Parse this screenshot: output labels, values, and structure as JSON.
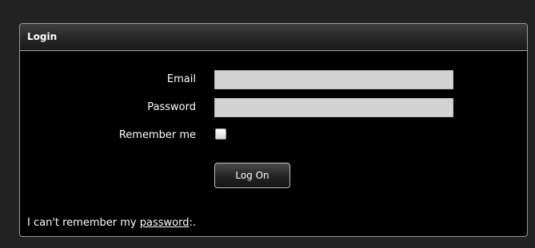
{
  "login_panel": {
    "title": "Login",
    "email_label": "Email",
    "email_value": "",
    "password_label": "Password",
    "password_value": "",
    "remember_label": "Remember me",
    "remember_checked": false,
    "submit_label": "Log On",
    "forgot_prefix": "I can't remember my ",
    "forgot_link": "password",
    "forgot_suffix": ":."
  },
  "colors": {
    "page_background": "#222222",
    "panel_background": "#000000",
    "field_background": "#d3d3d3",
    "text": "#ffffff"
  }
}
